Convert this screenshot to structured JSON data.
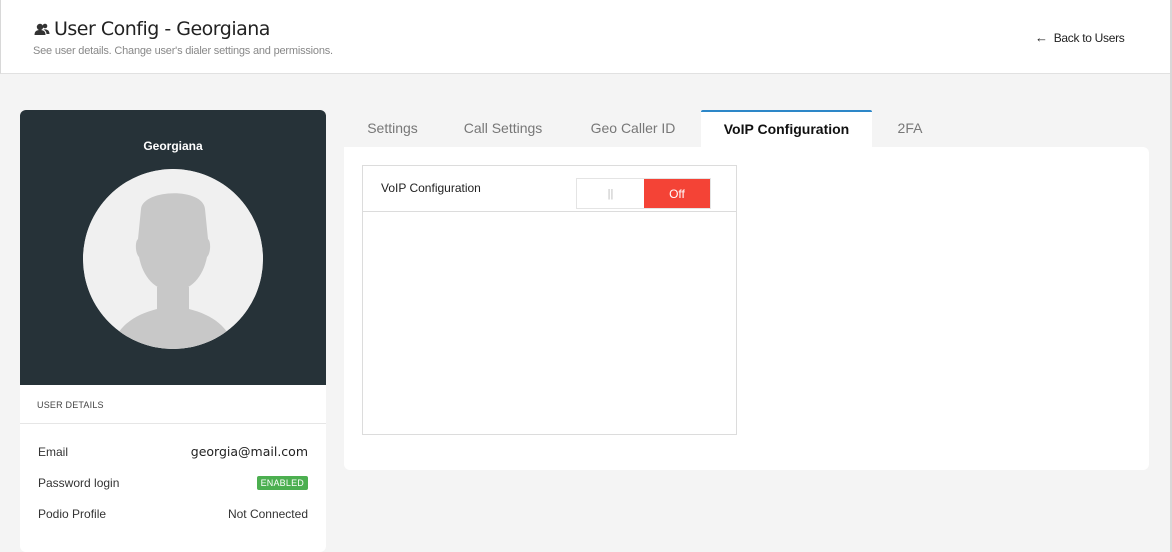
{
  "header": {
    "title": "User Config - Georgiana",
    "subtitle": "See user details. Change user's dialer settings and permissions.",
    "back_label": "Back to Users"
  },
  "profile": {
    "name": "Georgiana",
    "details_header": "USER DETAILS",
    "rows": [
      {
        "label": "Email",
        "value": "georgia@mail.com"
      },
      {
        "label": "Password login",
        "value": "ENABLED"
      },
      {
        "label": "Podio Profile",
        "value": "Not Connected"
      }
    ]
  },
  "tabs": [
    {
      "label": "Settings",
      "active": false
    },
    {
      "label": "Call Settings",
      "active": false
    },
    {
      "label": "Geo Caller ID",
      "active": false
    },
    {
      "label": "VoIP Configuration",
      "active": true
    },
    {
      "label": "2FA",
      "active": false
    }
  ],
  "voip": {
    "label": "VoIP Configuration",
    "toggle_on_glyph": "||",
    "toggle_state": "Off"
  },
  "colors": {
    "profile_bg": "#263238",
    "badge_green": "#4caf50",
    "toggle_off_red": "#f44336",
    "active_tab_accent": "#2d87c8"
  },
  "icons": {
    "title_icon": "user-group-icon",
    "back_icon": "arrow-left-icon",
    "avatar": "person-silhouette"
  }
}
